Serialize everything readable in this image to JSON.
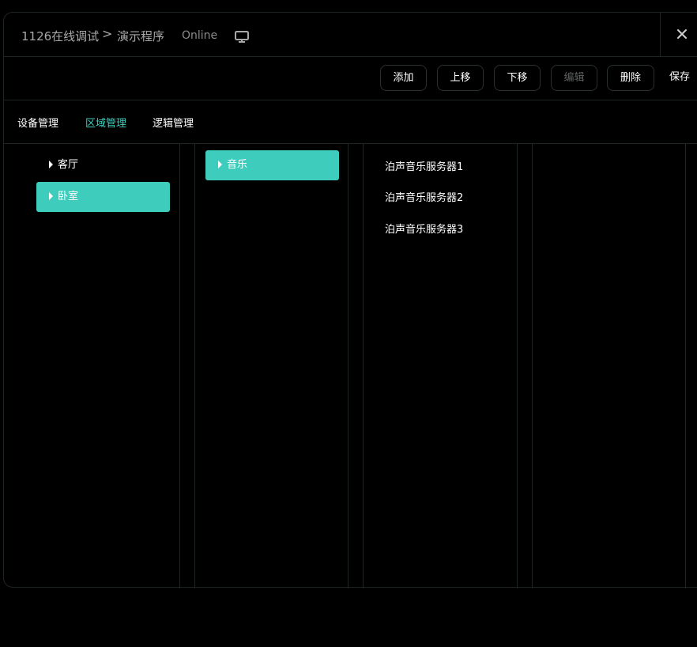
{
  "header": {
    "project": "1126在线调试",
    "separator": ">",
    "program": "演示程序",
    "status": "Online",
    "monitor_icon": "monitor-icon",
    "close_icon": "close-icon"
  },
  "toolbar": {
    "add": "添加",
    "move_up": "上移",
    "move_down": "下移",
    "edit": "编辑",
    "delete": "删除",
    "save": "保存"
  },
  "tabs": [
    {
      "label": "设备管理",
      "active": false
    },
    {
      "label": "区域管理",
      "active": true
    },
    {
      "label": "逻辑管理",
      "active": false
    }
  ],
  "rooms": [
    {
      "label": "客厅",
      "selected": false
    },
    {
      "label": "卧室",
      "selected": true
    }
  ],
  "subsystems": [
    {
      "label": "音乐",
      "selected": true
    }
  ],
  "devices": [
    {
      "label": "泊声音乐服务器1"
    },
    {
      "label": "泊声音乐服务器2"
    },
    {
      "label": "泊声音乐服务器3"
    }
  ],
  "colors": {
    "accent": "#3ecdbd",
    "background": "#000000",
    "border": "#1f2424",
    "muted_text": "#a8a8a8",
    "disabled_text": "#5e6262"
  }
}
